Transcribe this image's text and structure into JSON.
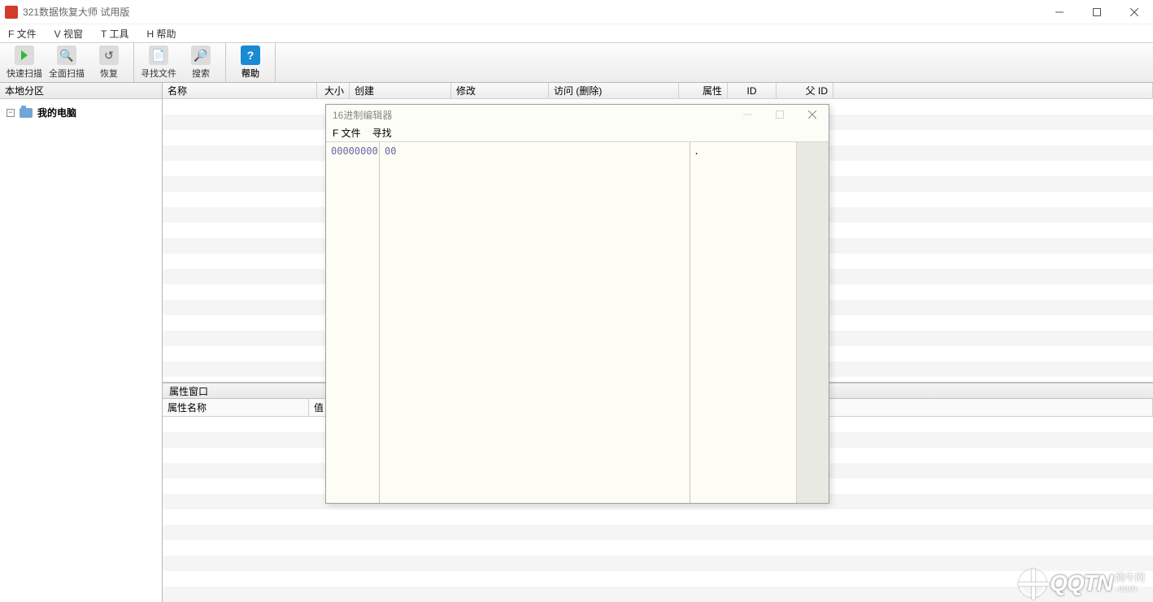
{
  "titlebar": {
    "title": "321数据恢复大师 试用版"
  },
  "menus": {
    "file": "F 文件",
    "view": "V 视窗",
    "tools": "T 工具",
    "help": "H 帮助"
  },
  "toolbar": {
    "quick_scan": "快速扫描",
    "full_scan": "全面扫描",
    "recover": "恢复",
    "find_file": "寻找文件",
    "search": "搜索",
    "help": "帮助"
  },
  "sidebar": {
    "header": "本地分区",
    "root": "我的电脑"
  },
  "columns": {
    "name": "名称",
    "size": "大小",
    "created": "创建",
    "modified": "修改",
    "accessed": "访问 (删除)",
    "attr": "属性",
    "id": "ID",
    "parent_id": "父 ID"
  },
  "prop_panel": {
    "header": "属性窗口",
    "col_name": "属性名称",
    "col_value": "值"
  },
  "hex": {
    "title": "16进制编辑器",
    "menu_file": "F 文件",
    "menu_find": "寻找",
    "offset": "00000000",
    "bytes": "00",
    "ascii": "."
  },
  "watermark": {
    "brand": "QQTN",
    "tld": ".com",
    "cn": "腾牛网"
  }
}
